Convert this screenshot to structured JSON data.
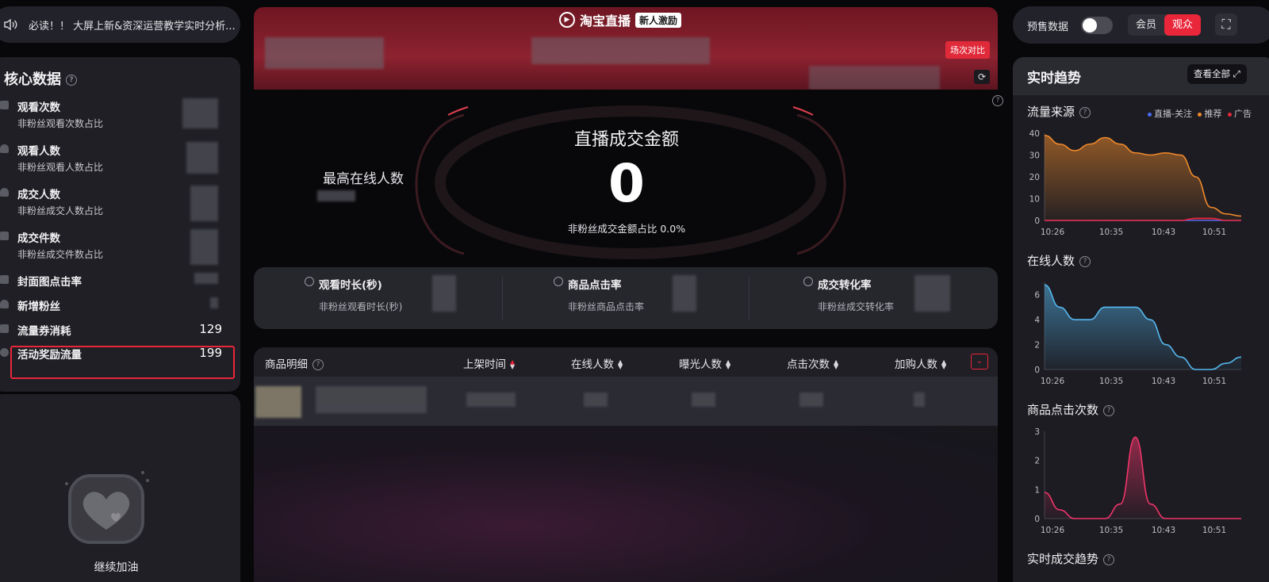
{
  "notice": {
    "text": "必读！！ 大屏上新&资深运营教学实时分析..."
  },
  "core": {
    "title": "核心数据",
    "metrics": [
      {
        "label": "观看次数",
        "sub": "非粉丝观看次数占比"
      },
      {
        "label": "观看人数",
        "sub": "非粉丝观看人数占比"
      },
      {
        "label": "成交人数",
        "sub": "非粉丝成交人数占比"
      },
      {
        "label": "成交件数",
        "sub": "非粉丝成交件数占比"
      },
      {
        "label": "封面图点击率"
      },
      {
        "label": "新增粉丝"
      },
      {
        "label": "流量券消耗",
        "value": "129"
      },
      {
        "label": "活动奖励流量",
        "value": "199"
      }
    ]
  },
  "cheer": {
    "text": "继续加油"
  },
  "banner": {
    "brand": "淘宝直播",
    "badge": "新人激励",
    "compare_button": "场次对比",
    "refresh_icon": "refresh-icon"
  },
  "gmv": {
    "title": "直播成交金额",
    "value": "0",
    "sub": "非粉丝成交金额占比 0.0%",
    "peak_label": "最高在线人数"
  },
  "stats": [
    {
      "label": "观看时长(秒)",
      "sub": "非粉丝观看时长(秒)",
      "icon": "clock-icon"
    },
    {
      "label": "商品点击率",
      "sub": "非粉丝商品点击率",
      "icon": "click-icon"
    },
    {
      "label": "成交转化率",
      "sub": "非粉丝成交转化率",
      "icon": "conversion-icon"
    }
  ],
  "products": {
    "title": "商品明细",
    "columns": [
      "上架时间",
      "在线人数",
      "曝光人数",
      "点击次数",
      "加购人数"
    ]
  },
  "toggles": {
    "presale_label": "预售数据",
    "presale_on": false,
    "segment": [
      "会员",
      "观众"
    ],
    "segment_active": "观众"
  },
  "trend": {
    "title": "实时趋势",
    "view_all": "查看全部",
    "legend": [
      "直播-关注",
      "推荐",
      "广告"
    ]
  },
  "chart_data": [
    {
      "type": "area",
      "title": "流量来源",
      "x": [
        "10:26",
        "10:35",
        "10:43",
        "10:51"
      ],
      "ylim": [
        0,
        40
      ],
      "yticks": [
        0,
        10,
        20,
        30,
        40
      ],
      "series": [
        {
          "name": "直播-关注",
          "color": "#4a6cf7",
          "values": [
            0,
            0,
            0,
            0,
            0,
            0,
            0,
            0,
            0,
            0,
            0,
            0,
            0,
            0
          ]
        },
        {
          "name": "推荐",
          "color": "#f08a2c",
          "values": [
            39,
            35,
            32,
            35,
            38,
            35,
            31,
            30,
            31,
            30,
            20,
            6,
            3,
            2
          ]
        },
        {
          "name": "广告",
          "color": "#e9263a",
          "values": [
            0,
            0,
            0,
            0,
            0,
            0,
            0,
            0,
            0,
            0,
            1,
            1,
            0,
            0
          ]
        }
      ]
    },
    {
      "type": "area",
      "title": "在线人数",
      "x": [
        "10:26",
        "10:35",
        "10:43",
        "10:51"
      ],
      "ylim": [
        0,
        7
      ],
      "yticks": [
        0,
        2,
        4,
        6
      ],
      "series": [
        {
          "color": "#56b8f0",
          "values": [
            6.8,
            5,
            4,
            4,
            5,
            5,
            5,
            4,
            2,
            1,
            0,
            0,
            0.5,
            1
          ]
        }
      ]
    },
    {
      "type": "area",
      "title": "商品点击次数",
      "x": [
        "10:26",
        "10:35",
        "10:43",
        "10:51"
      ],
      "ylim": [
        0,
        3
      ],
      "yticks": [
        0,
        1,
        2,
        3
      ],
      "series": [
        {
          "color": "#f0356a",
          "values": [
            0.9,
            0.3,
            0,
            0,
            0,
            0.5,
            2.8,
            0.5,
            0,
            0,
            0,
            0,
            0,
            0
          ]
        }
      ]
    },
    {
      "type": "area",
      "title": "实时成交趋势",
      "series": []
    }
  ]
}
